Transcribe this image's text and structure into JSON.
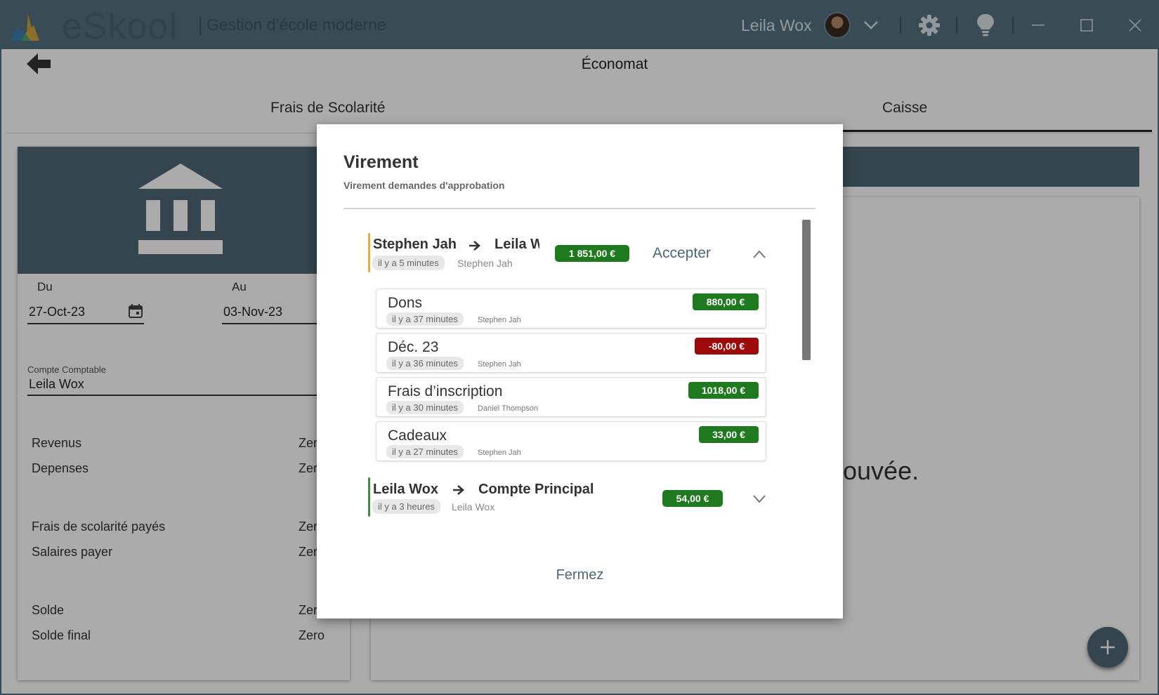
{
  "titlebar": {
    "app_name": "eSkool",
    "tagline": "Gestion d’école moderne",
    "user_name": "Leila Wox"
  },
  "page": {
    "title": "Économat",
    "tabs": [
      {
        "label": "Frais de Scolarité"
      },
      {
        "label": "Caisse"
      }
    ]
  },
  "left_panel": {
    "from_label": "Du",
    "from_value": "27-Oct-23",
    "to_label": "Au",
    "to_value": "03-Nov-23",
    "account_label": "Compte Comptable",
    "account_value": "Leila Wox",
    "stats": [
      {
        "label": "Revenus",
        "value": "Zer"
      },
      {
        "label": "Depenses",
        "value": "Zer"
      },
      {
        "label": "Frais de scolarité payés",
        "value": "Zer"
      },
      {
        "label": "Salaires payer",
        "value": "Zer"
      },
      {
        "label": "Solde",
        "value": "Zer"
      },
      {
        "label": "Solde final",
        "value": "Zero"
      }
    ]
  },
  "right_panel": {
    "empty_text": "ouvée."
  },
  "dialog": {
    "title": "Virement",
    "subtitle": "Virement demandes d'approbation",
    "accept_label": "Accepter",
    "close_label": "Fermez",
    "groups": [
      {
        "from": "Stephen Jah",
        "to": "Leila Wox",
        "time": "il y a 5 minutes",
        "by": "Stephen Jah",
        "amount": "1 851,00 €",
        "accent": "#f0a83c",
        "items": [
          {
            "title": "Dons",
            "time": "il y a 37 minutes",
            "by": "Stephen Jah",
            "amount": "880,00 €",
            "color": "#1f7a1f"
          },
          {
            "title": "Déc. 23",
            "time": "il y a 36 minutes",
            "by": "Stephen Jah",
            "amount": "-80,00 €",
            "color": "#9e0a0a"
          },
          {
            "title": "Frais d’inscription",
            "time": "il y a 30 minutes",
            "by": "Daniel Thompson",
            "amount": "1018,00 €",
            "color": "#1f7a1f"
          },
          {
            "title": "Cadeaux",
            "time": "il y a 27 minutes",
            "by": "Stephen Jah",
            "amount": "33,00 €",
            "color": "#1f7a1f"
          }
        ]
      },
      {
        "from": "Leila Wox",
        "to": "Compte Principal",
        "time": "il y a 3 heures",
        "by": "Leila Wox",
        "amount": "54,00 €",
        "accent": "#3c8f3c"
      }
    ]
  },
  "colors": {
    "titlebar": "#55707f",
    "panel_header": "#4e6877",
    "positive": "#1f7a1f",
    "negative": "#9e0a0a"
  },
  "icons": [
    "logo-icon",
    "back-arrow-icon",
    "chevron-down-icon",
    "gear-icon",
    "lightbulb-icon",
    "minimize-icon",
    "maximize-icon",
    "close-icon",
    "bank-icon",
    "calendar-icon",
    "arrow-right-icon",
    "chevron-up-icon",
    "plus-icon"
  ]
}
